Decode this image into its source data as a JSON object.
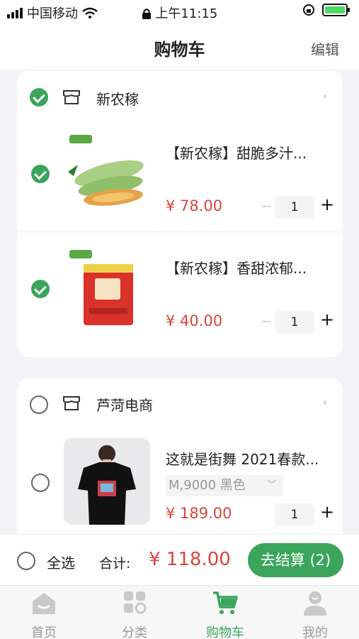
{
  "status_bar": {
    "carrier": "中国移动",
    "time": "上午11:15"
  },
  "header": {
    "title": "购物车",
    "edit_label": "编辑"
  },
  "shops": [
    {
      "name": "新农稼",
      "selected": true,
      "items": [
        {
          "title": "【新农稼】甜脆多汁...",
          "price": "¥ 78.00",
          "quantity": "1",
          "selected": true,
          "image": "melon-image"
        },
        {
          "title": "【新农稼】香甜浓郁...",
          "price": "¥ 40.00",
          "quantity": "1",
          "selected": true,
          "image": "snack-bag-image"
        }
      ]
    },
    {
      "name": "芦菏电商",
      "selected": false,
      "items": [
        {
          "title": "这就是街舞 2021春款...",
          "variant": "M,9000 黑色",
          "price": "¥ 189.00",
          "quantity": "1",
          "selected": false,
          "image": "tshirt-model-image"
        }
      ]
    }
  ],
  "checkout": {
    "select_all_label": "全选",
    "total_label": "合计:",
    "total_price": "¥ 118.00",
    "button_label": "去结算 (2)"
  },
  "tabbar": [
    {
      "label": "首页",
      "icon": "home-icon",
      "active": false
    },
    {
      "label": "分类",
      "icon": "category-icon",
      "active": false
    },
    {
      "label": "购物车",
      "icon": "cart-icon",
      "active": true
    },
    {
      "label": "我的",
      "icon": "profile-icon",
      "active": false
    }
  ],
  "colors": {
    "accent": "#3aa55b",
    "price": "#d9453c"
  }
}
